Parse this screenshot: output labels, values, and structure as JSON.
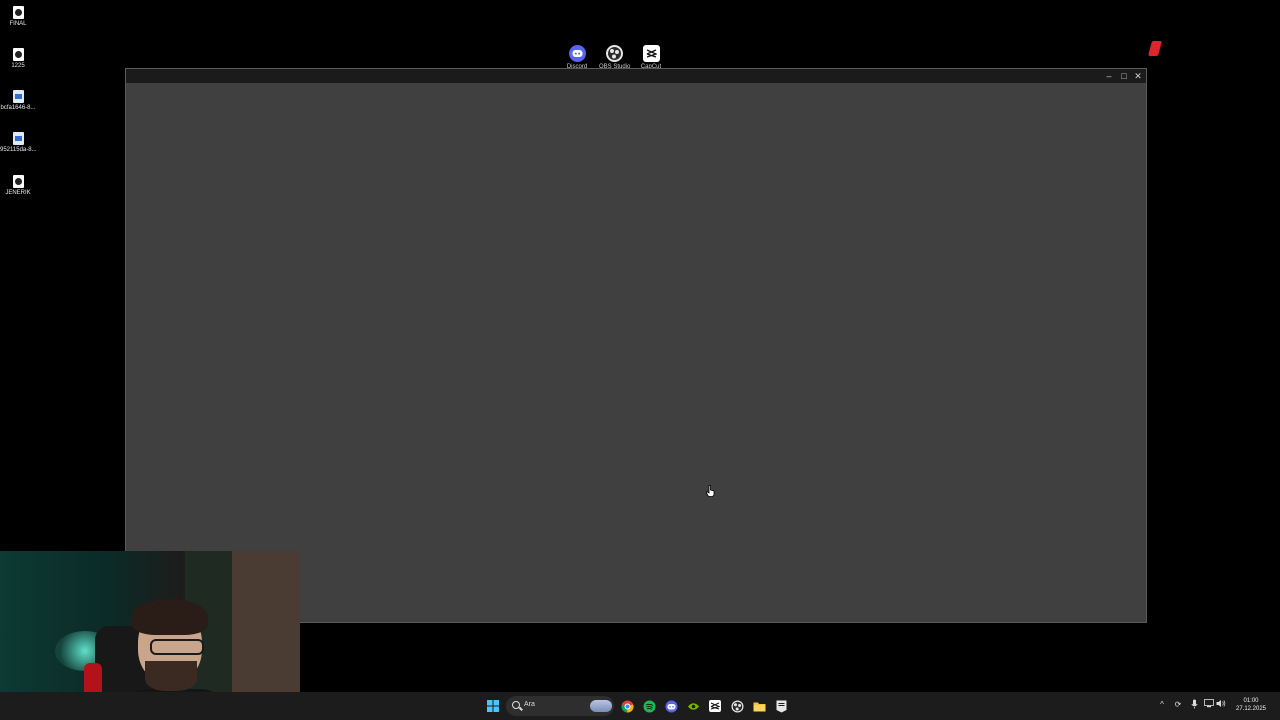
{
  "desktop": {
    "icons": [
      {
        "label": "FINAL",
        "type": "video"
      },
      {
        "label": "1225",
        "type": "video"
      },
      {
        "label": "bcfa1646-8...",
        "type": "document"
      },
      {
        "label": "952115da-8...",
        "type": "document"
      },
      {
        "label": "JENERIK",
        "type": "video"
      }
    ],
    "shortcuts": [
      {
        "label": "Discord",
        "icon": "discord-icon",
        "color": "#5865f2"
      },
      {
        "label": "OBS Studio",
        "icon": "obs-icon",
        "color": "#e6e6e6"
      },
      {
        "label": "CapCut",
        "icon": "capcut-icon",
        "color": "#ffffff"
      }
    ]
  },
  "window": {
    "controls": {
      "minimize": "–",
      "maximize": "□",
      "close": "✕"
    },
    "background_color": "#404040"
  },
  "taskbar": {
    "search_placeholder": "Ara",
    "apps": [
      {
        "name": "start",
        "icon": "windows-start-icon",
        "color": "#4cc2ff"
      },
      {
        "name": "chrome",
        "icon": "chrome-icon",
        "color": "#f2b300"
      },
      {
        "name": "spotify",
        "icon": "spotify-icon",
        "color": "#1db954"
      },
      {
        "name": "discord",
        "icon": "discord-icon",
        "color": "#5865f2"
      },
      {
        "name": "nvidia",
        "icon": "nvidia-icon",
        "color": "#76b900"
      },
      {
        "name": "capcut",
        "icon": "capcut-icon",
        "color": "#ffffff"
      },
      {
        "name": "obs",
        "icon": "obs-icon",
        "color": "#e6e6e6"
      },
      {
        "name": "file-explorer",
        "icon": "folder-icon",
        "color": "#f5c242"
      },
      {
        "name": "epic-games",
        "icon": "epic-games-icon",
        "color": "#e6e6e6"
      }
    ],
    "clock": {
      "time": "01:00",
      "date": "27.12.2025"
    }
  }
}
